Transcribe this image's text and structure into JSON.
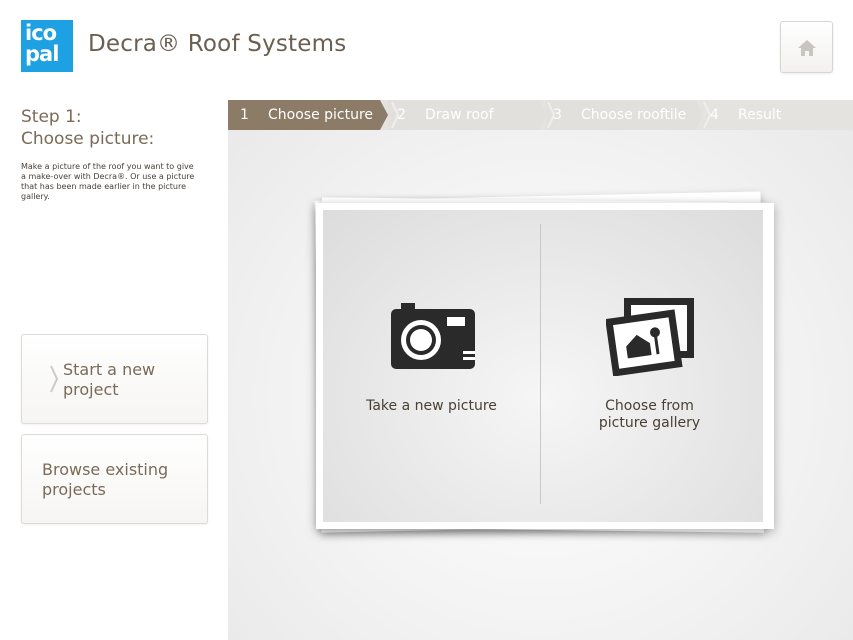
{
  "header": {
    "logo_line1": "ico",
    "logo_line2": "pal",
    "title": "Decra® Roof Systems",
    "home_icon": "home-icon"
  },
  "sidebar": {
    "step_title": "Step 1:",
    "step_subtitle": "Choose picture:",
    "description": "Make a picture of the roof you want to give a make-over with Decra®. Or use a picture that has been made earlier in the picture gallery.",
    "buttons": [
      {
        "label": "Start a new project"
      },
      {
        "label": "Browse existing projects"
      }
    ]
  },
  "steps": [
    {
      "num": "1",
      "label": "Choose picture",
      "active": true
    },
    {
      "num": "2",
      "label": "Draw roof",
      "active": false
    },
    {
      "num": "3",
      "label": "Choose rooftile",
      "active": false
    },
    {
      "num": "4",
      "label": "Result",
      "active": false
    }
  ],
  "options": [
    {
      "label": "Take a new picture",
      "icon": "camera-icon"
    },
    {
      "label_line1": "Choose from",
      "label_line2": "picture gallery",
      "icon": "gallery-icon"
    }
  ],
  "colors": {
    "logo_blue": "#1da1e2",
    "step_active": "#8c7b66",
    "step_inactive": "#e5e3e0",
    "text_brown": "#7a6a57"
  }
}
